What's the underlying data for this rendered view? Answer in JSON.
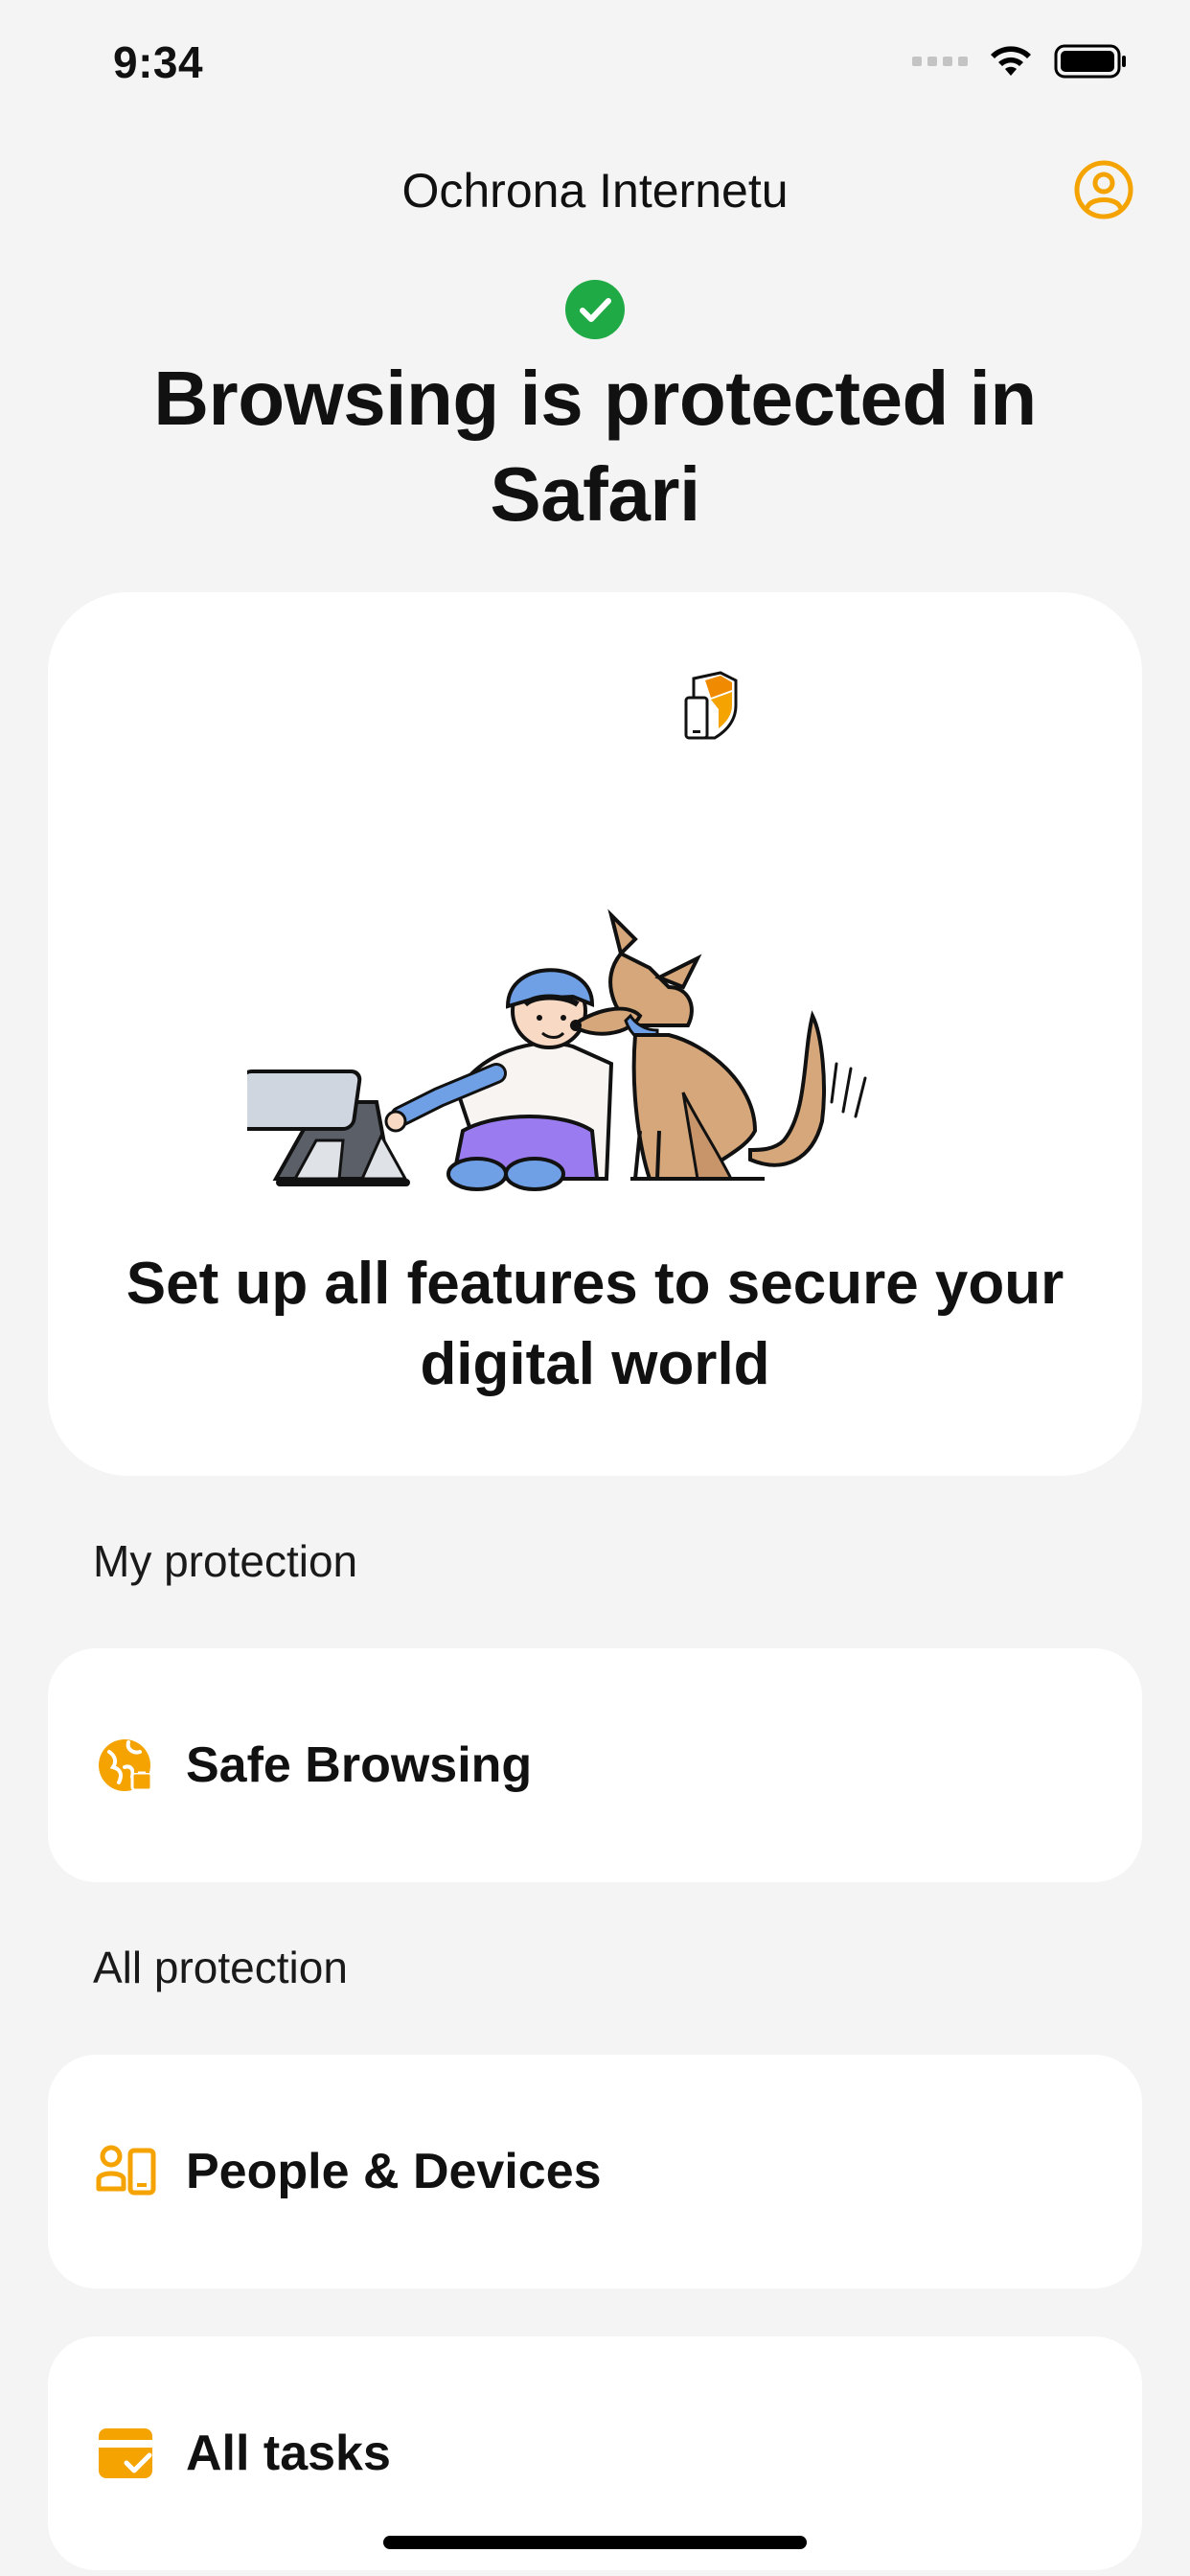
{
  "status_bar": {
    "time": "9:34"
  },
  "nav": {
    "title": "Ochrona Internetu",
    "profile_icon": "person-circle-icon"
  },
  "hero": {
    "status_icon": "check-circle-icon",
    "title": "Browsing is protected in Safari"
  },
  "feature_card": {
    "logo_icon": "shield-device-icon",
    "illustration": "child-with-dog-and-tablet",
    "text": "Set up all features to secure your digital world"
  },
  "sections": {
    "my_protection": {
      "label": "My protection",
      "items": [
        {
          "label": "Safe Browsing",
          "icon": "globe-lock-icon"
        }
      ]
    },
    "all_protection": {
      "label": "All protection",
      "items": [
        {
          "label": "People & Devices",
          "icon": "people-devices-icon"
        },
        {
          "label": "All tasks",
          "icon": "tasks-card-icon"
        }
      ]
    }
  },
  "colors": {
    "accent": "#f4a300",
    "success": "#1faa45",
    "background": "#f4f4f4",
    "card": "#ffffff"
  }
}
